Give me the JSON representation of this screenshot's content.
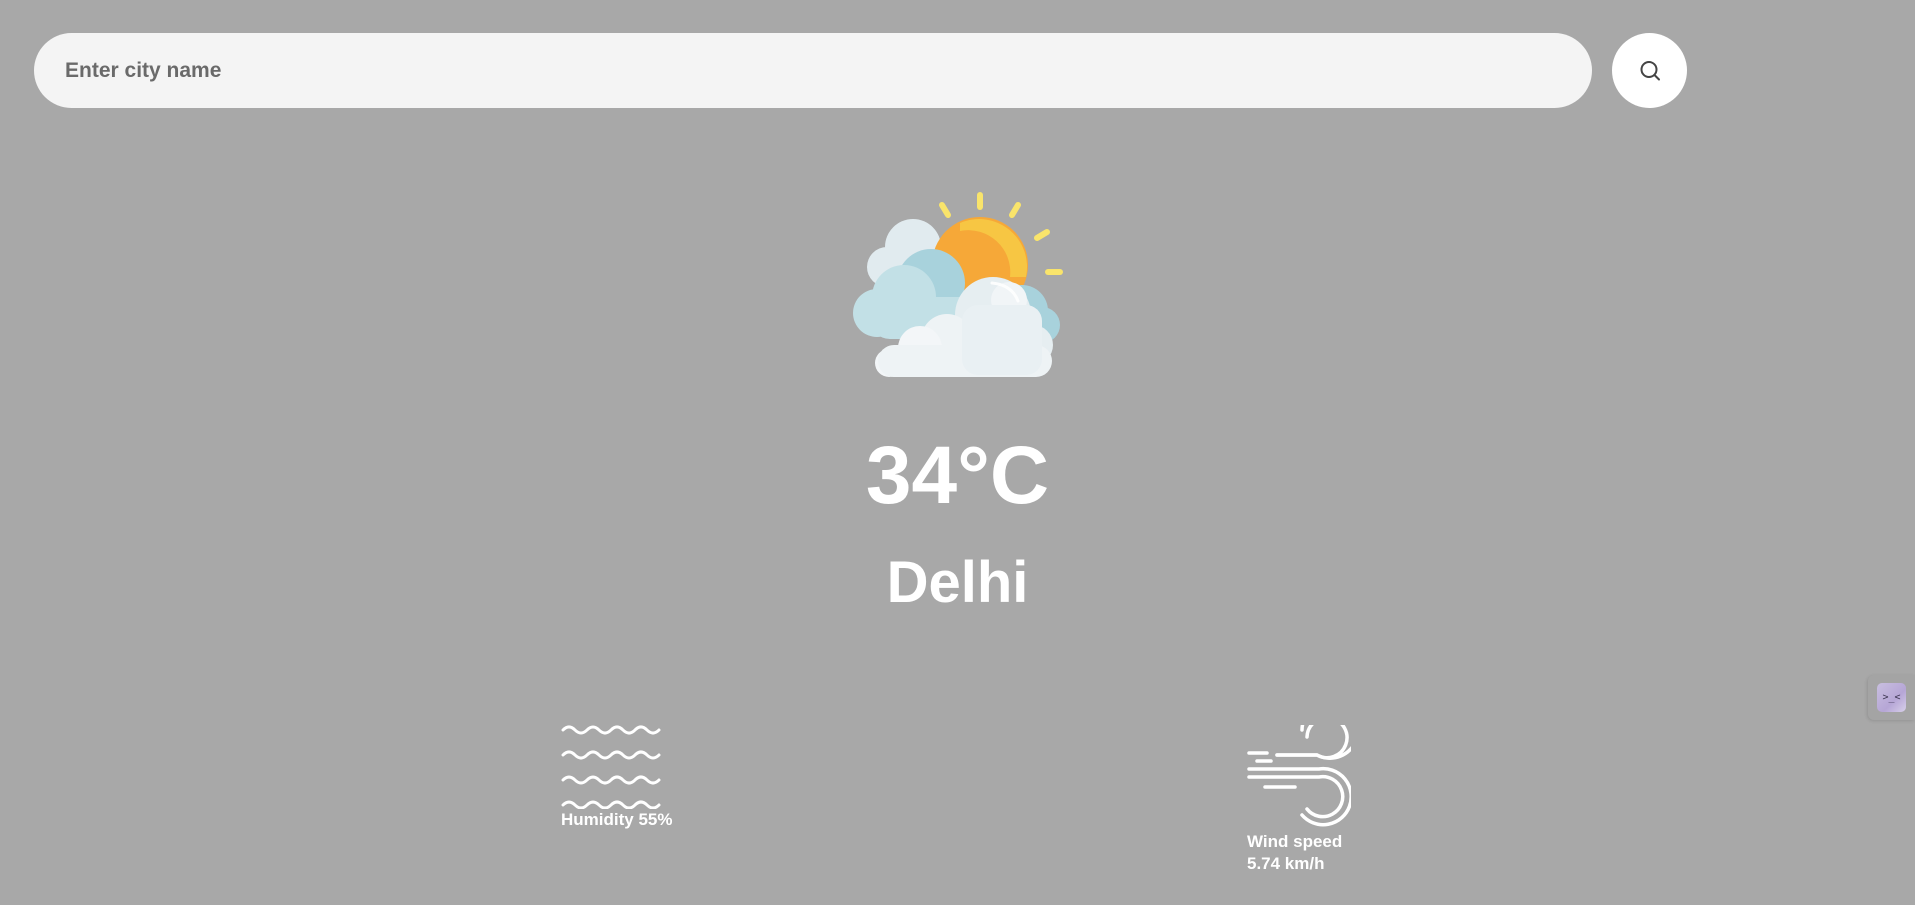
{
  "search": {
    "placeholder": "Enter city name",
    "value": "",
    "button_icon": "search-icon"
  },
  "weather": {
    "icon": "partly-cloudy-sun-icon",
    "temperature": "34°C",
    "city": "Delhi"
  },
  "details": {
    "humidity": {
      "icon": "humidity-waves-icon",
      "label": "Humidity 55%"
    },
    "wind": {
      "icon": "wind-icon",
      "label_line1": "Wind speed",
      "label_line2": "5.74 km/h"
    }
  },
  "side_widget": {
    "icon": "assistant-face-icon",
    "glyph": ">_<"
  },
  "colors": {
    "background": "#a8a8a8",
    "search_bg": "#f4f4f4",
    "text": "#ffffff",
    "sun": "#f7a93b",
    "cloud": "#eef3f6",
    "cloud_shadow": "#a9d3dd"
  }
}
